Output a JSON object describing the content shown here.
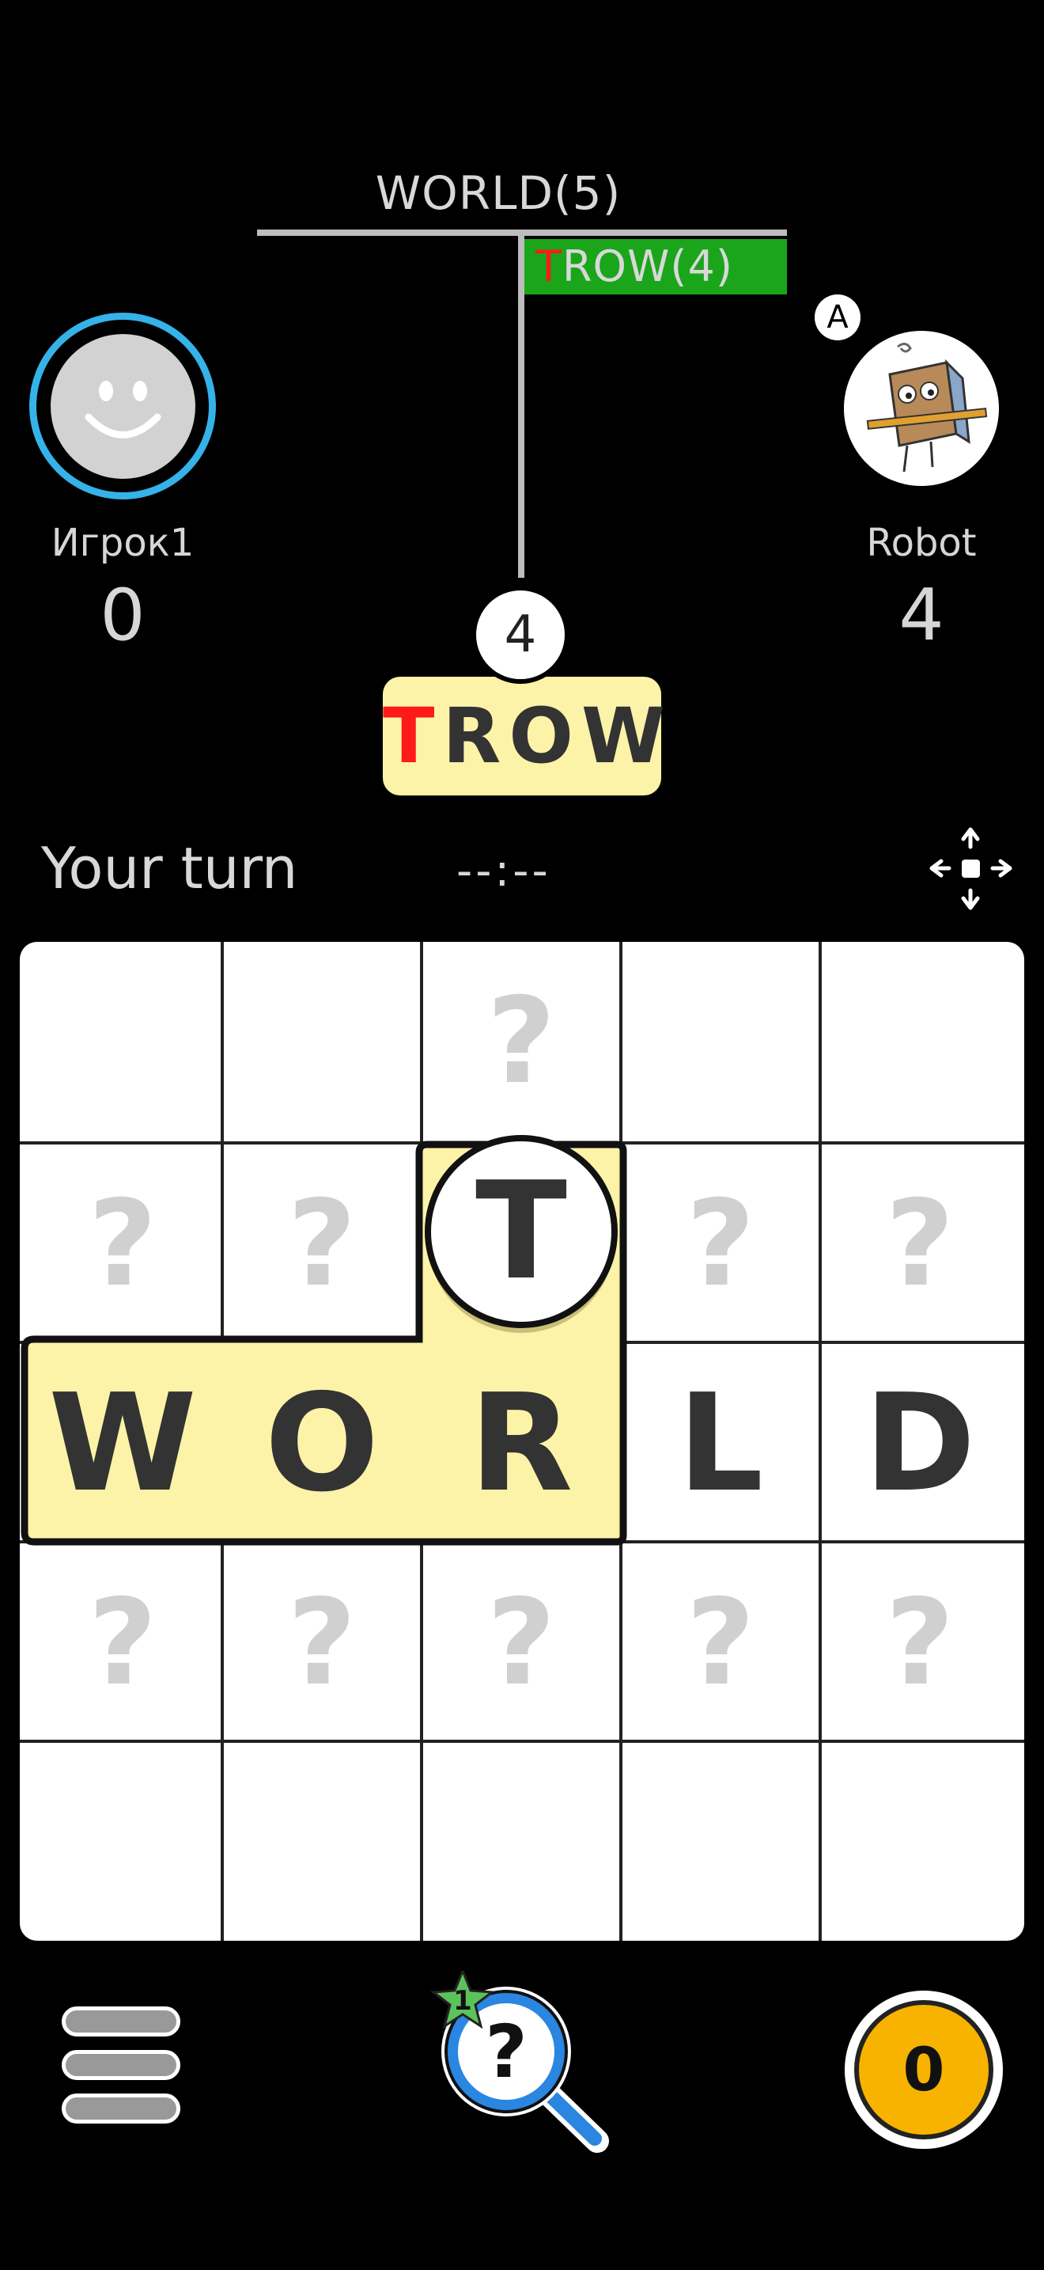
{
  "history": {
    "word1": "WORLD(5)",
    "word2_first": "T",
    "word2_rest": "ROW(4)"
  },
  "player1": {
    "name": "Игрок1",
    "score": "0",
    "avatar": "smiley-face-avatar"
  },
  "player2": {
    "name": "Robot",
    "score": "4",
    "badge": "A",
    "avatar": "robot-cartoon-avatar"
  },
  "last_move": {
    "score": "4",
    "first_letter": "T",
    "rest": "ROW"
  },
  "status": {
    "turn": "Your turn",
    "timer": "--:--"
  },
  "board": {
    "rows": [
      [
        "",
        "",
        "?",
        "",
        ""
      ],
      [
        "?",
        "?",
        "T",
        "?",
        "?"
      ],
      [
        "W",
        "O",
        "R",
        "L",
        "D"
      ],
      [
        "?",
        "?",
        "?",
        "?",
        "?"
      ],
      [
        "",
        "",
        "",
        "",
        ""
      ]
    ]
  },
  "hint": {
    "badge": "1",
    "icon": "magnifier-question-icon"
  },
  "coins": {
    "value": "0"
  },
  "colors": {
    "accent_blue": "#35b2e8",
    "history_green": "#1aa51a",
    "highlight": "#fdf3a8",
    "coin": "#f7b300",
    "red_letter": "#ff1a1a"
  }
}
